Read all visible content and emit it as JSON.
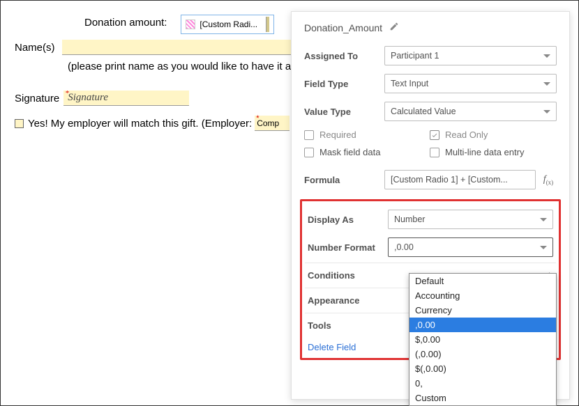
{
  "form": {
    "donation_label": "Donation amount:",
    "chip_text": "[Custom Radi...",
    "names_label": "Name(s)",
    "names_hint": "(please print name as you would like to have it ap",
    "signature_label": "Signature",
    "signature_placeholder": "Signature",
    "yes_label": "Yes!  My employer will match this gift.  (Employer:",
    "company_short": "Comp",
    "yes_checked": "☐"
  },
  "panel": {
    "field_name": "Donation_Amount",
    "assigned_to": {
      "label": "Assigned To",
      "value": "Participant 1"
    },
    "field_type": {
      "label": "Field Type",
      "value": "Text Input"
    },
    "value_type": {
      "label": "Value Type",
      "value": "Calculated Value"
    },
    "checks": {
      "required": "Required",
      "readonly": "Read Only",
      "mask": "Mask field data",
      "multiline": "Multi-line data entry"
    },
    "formula": {
      "label": "Formula",
      "value": "[Custom Radio 1] + [Custom..."
    },
    "display_as": {
      "label": "Display As",
      "value": "Number"
    },
    "number_format": {
      "label": "Number Format",
      "value": ",0.00"
    },
    "sections": {
      "conditions": "Conditions",
      "appearance": "Appearance",
      "tools": "Tools"
    },
    "delete_label": "Delete Field",
    "format_options": [
      "Default",
      "Accounting",
      "Currency",
      ",0.00",
      "$,0.00",
      "(,0.00)",
      "$(,0.00)",
      "0,",
      "Custom"
    ],
    "selected_format_index": 3
  }
}
